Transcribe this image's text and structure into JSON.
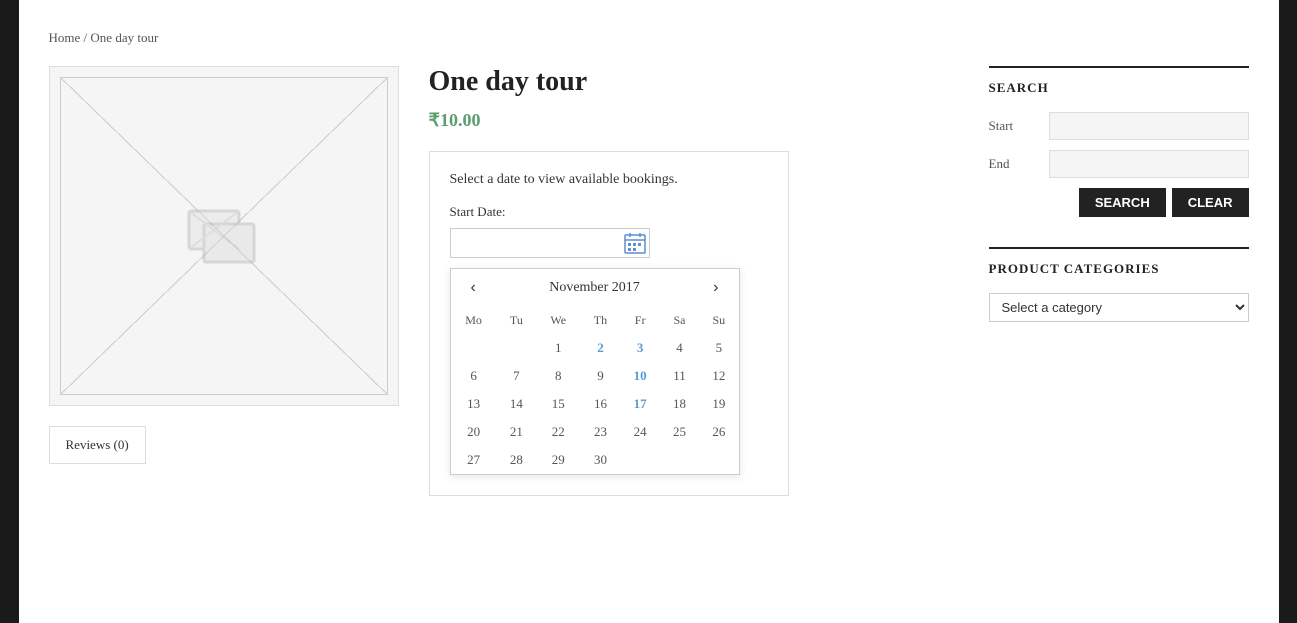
{
  "breadcrumb": {
    "home_label": "Home",
    "separator": " / ",
    "current_label": "One day tour"
  },
  "product": {
    "title": "One day tour",
    "price": "₹10.00",
    "booking_prompt": "Select a date to view available bookings.",
    "start_date_label": "Start Date:"
  },
  "calendar": {
    "month_year": "November 2017",
    "prev_icon": "‹",
    "next_icon": "›",
    "day_headers": [
      "Mo",
      "Tu",
      "We",
      "Th",
      "Fr",
      "Sa",
      "Su"
    ],
    "weeks": [
      [
        "",
        "",
        "1",
        "2",
        "3",
        "4",
        "5"
      ],
      [
        "6",
        "7",
        "8",
        "9",
        "10",
        "11",
        "12"
      ],
      [
        "13",
        "14",
        "15",
        "16",
        "17",
        "18",
        "19"
      ],
      [
        "20",
        "21",
        "22",
        "23",
        "24",
        "25",
        "26"
      ],
      [
        "27",
        "28",
        "29",
        "30",
        "",
        "",
        ""
      ]
    ],
    "highlighted_dates": [
      "2",
      "3",
      "10",
      "17"
    ]
  },
  "reviews_tab": {
    "label": "Reviews (0)"
  },
  "sidebar": {
    "search_section": {
      "title": "SEARCH",
      "start_label": "Start",
      "end_label": "End",
      "search_btn": "SEARCH",
      "clear_btn": "CLEAR",
      "start_placeholder": "",
      "end_placeholder": ""
    },
    "categories_section": {
      "title": "PRODUCT CATEGORIES",
      "select_placeholder": "Select a category",
      "options": [
        "Select a category"
      ]
    }
  }
}
